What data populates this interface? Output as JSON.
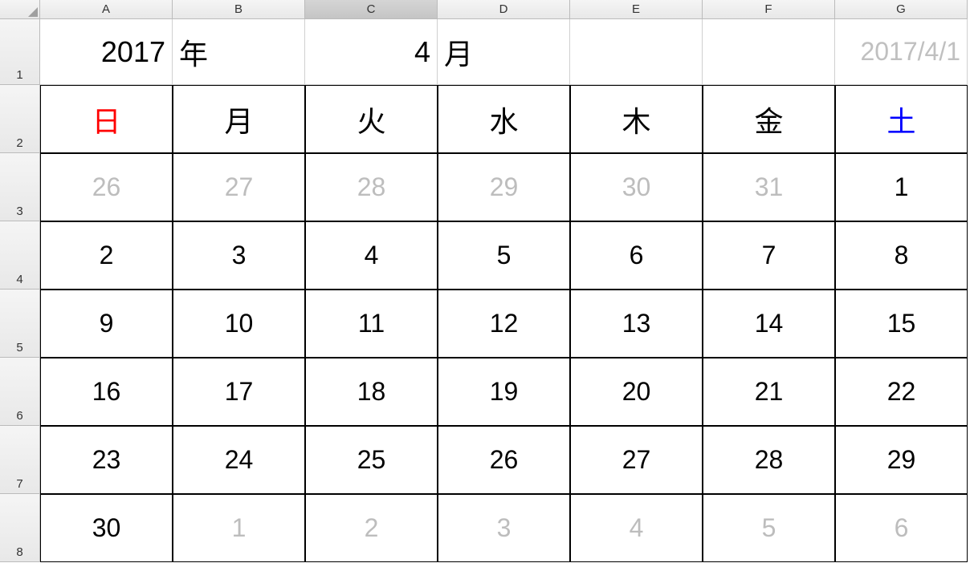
{
  "columns": [
    "A",
    "B",
    "C",
    "D",
    "E",
    "F",
    "G"
  ],
  "selected_column": "C",
  "rows": [
    "1",
    "2",
    "3",
    "4",
    "5",
    "6",
    "7",
    "8"
  ],
  "header_row": {
    "year_value": "2017",
    "year_label": "年",
    "month_value": "4",
    "month_label": "月",
    "helper_date": "2017/4/1"
  },
  "day_names": [
    "日",
    "月",
    "火",
    "水",
    "木",
    "金",
    "土"
  ],
  "calendar": [
    [
      {
        "v": "26",
        "muted": true
      },
      {
        "v": "27",
        "muted": true
      },
      {
        "v": "28",
        "muted": true
      },
      {
        "v": "29",
        "muted": true
      },
      {
        "v": "30",
        "muted": true
      },
      {
        "v": "31",
        "muted": true
      },
      {
        "v": "1",
        "muted": false
      }
    ],
    [
      {
        "v": "2",
        "muted": false
      },
      {
        "v": "3",
        "muted": false
      },
      {
        "v": "4",
        "muted": false
      },
      {
        "v": "5",
        "muted": false
      },
      {
        "v": "6",
        "muted": false
      },
      {
        "v": "7",
        "muted": false
      },
      {
        "v": "8",
        "muted": false
      }
    ],
    [
      {
        "v": "9",
        "muted": false
      },
      {
        "v": "10",
        "muted": false
      },
      {
        "v": "11",
        "muted": false
      },
      {
        "v": "12",
        "muted": false
      },
      {
        "v": "13",
        "muted": false
      },
      {
        "v": "14",
        "muted": false
      },
      {
        "v": "15",
        "muted": false
      }
    ],
    [
      {
        "v": "16",
        "muted": false
      },
      {
        "v": "17",
        "muted": false
      },
      {
        "v": "18",
        "muted": false
      },
      {
        "v": "19",
        "muted": false
      },
      {
        "v": "20",
        "muted": false
      },
      {
        "v": "21",
        "muted": false
      },
      {
        "v": "22",
        "muted": false
      }
    ],
    [
      {
        "v": "23",
        "muted": false
      },
      {
        "v": "24",
        "muted": false
      },
      {
        "v": "25",
        "muted": false
      },
      {
        "v": "26",
        "muted": false
      },
      {
        "v": "27",
        "muted": false
      },
      {
        "v": "28",
        "muted": false
      },
      {
        "v": "29",
        "muted": false
      }
    ],
    [
      {
        "v": "30",
        "muted": false
      },
      {
        "v": "1",
        "muted": true
      },
      {
        "v": "2",
        "muted": true
      },
      {
        "v": "3",
        "muted": true
      },
      {
        "v": "4",
        "muted": true
      },
      {
        "v": "5",
        "muted": true
      },
      {
        "v": "6",
        "muted": true
      }
    ]
  ]
}
